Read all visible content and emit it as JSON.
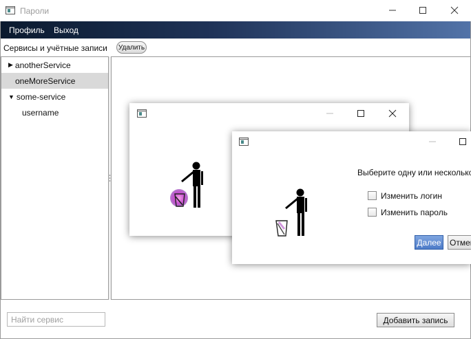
{
  "window": {
    "title": "Пароли"
  },
  "menu": {
    "profile": "Профиль",
    "exit": "Выход"
  },
  "toolbar": {
    "label": "Сервисы и учётные записи",
    "delete_label": "Удалить"
  },
  "tree": {
    "items": [
      {
        "label": "anotherService",
        "expander": "▶"
      },
      {
        "label": "oneMoreService"
      },
      {
        "label": "some-service",
        "expander": "▼"
      },
      {
        "label": "username"
      }
    ]
  },
  "search": {
    "placeholder": "Найти сервис"
  },
  "add_record_label": "Добавить запись",
  "dialog_options": {
    "prompt": "Выберите одну или несколько",
    "options": [
      "Изменить логин",
      "Изменить пароль"
    ],
    "next_label": "Далее",
    "cancel_label": "Отмена"
  },
  "colors": {
    "menubar_start": "#0b1a2e",
    "menubar_end": "#5273a8",
    "selected_item": "#d9d9d9",
    "primary_button": "#4d7bc8"
  },
  "icons": [
    "app-icon",
    "minimize-icon",
    "maximize-icon",
    "close-icon",
    "trash-figure-icon"
  ]
}
